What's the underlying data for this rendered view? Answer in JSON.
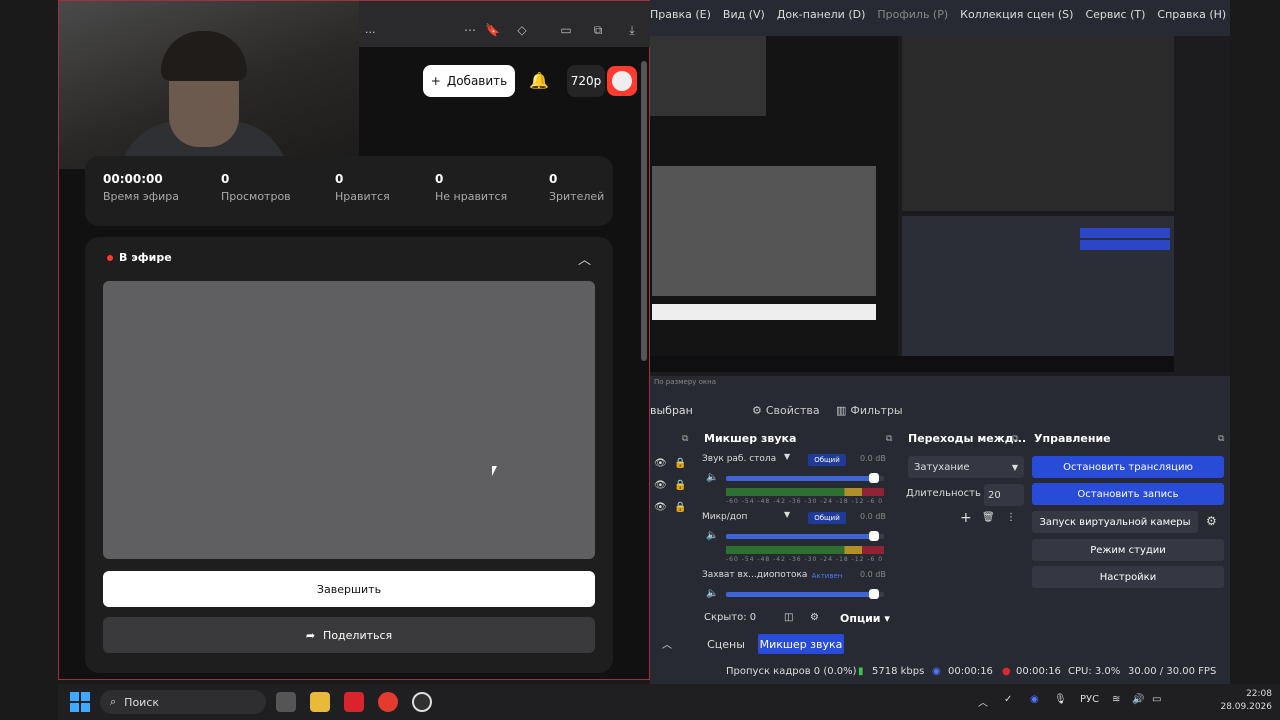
{
  "browser": {
    "add_label": "Добавить",
    "resolution": "720p",
    "addr": "...",
    "stats": [
      {
        "value": "00:00:00",
        "label": "Время эфира"
      },
      {
        "value": "0",
        "label": "Просмотров"
      },
      {
        "value": "0",
        "label": "Нравится"
      },
      {
        "value": "0",
        "label": "Не нравится"
      },
      {
        "value": "0",
        "label": "Зрителей"
      }
    ],
    "live_title": "В эфире",
    "end_label": "Завершить",
    "share_label": "Поделиться"
  },
  "obs": {
    "menu": [
      "Правка (E)",
      "Вид (V)",
      "Док-панели (D)",
      "Профиль (P)",
      "Коллекция сцен (S)",
      "Сервис (T)",
      "Справка (H)"
    ],
    "scale_label": "По размеру окна",
    "not_selected": "выбран",
    "props_tab": "Свойства",
    "filters_tab": "Фильтры",
    "mixer_title": "Микшер звука",
    "transitions_title": "Переходы межд...",
    "controls_title": "Управление",
    "mixer": [
      {
        "name": "Звук раб. стола",
        "badge": "Общий",
        "db": "0.0 dB",
        "level": 0.97
      },
      {
        "name": "Микр/доп",
        "badge": "Общий",
        "db": "0.0 dB",
        "level": 0.97
      },
      {
        "name": "Захват вх...диопотока",
        "badge": "Активен",
        "db": "0.0 dB",
        "level": 0.97
      }
    ],
    "meter_ticks": "-60 -54 -48 -42 -36 -30 -24 -18 -12 -6 0",
    "transition": "Затухание",
    "duration_label": "Длительность",
    "duration_value": "20",
    "controls": [
      {
        "label": "Остановить трансляцию",
        "style": "blue"
      },
      {
        "label": "Остановить запись",
        "style": "blue"
      },
      {
        "label": "Запуск виртуальной камеры",
        "style": "gray"
      },
      {
        "label": "Режим студии",
        "style": "gray"
      },
      {
        "label": "Настройки",
        "style": "gray"
      }
    ],
    "hidden_label": "Скрыто: 0",
    "options_label": "Опции",
    "tabs": [
      "Сцены",
      "Микшер звука"
    ],
    "status": {
      "dropped": "Пропуск кадров 0 (0.0%)",
      "bitrate": "5718 kbps",
      "stream_time": "00:00:16",
      "rec_time": "00:00:16",
      "cpu": "CPU: 3.0%",
      "fps": "30.00 / 30.00 FPS"
    }
  },
  "taskbar": {
    "search": "Поиск",
    "lang": "РУС",
    "time": "22:08",
    "date": "28.09.2026"
  },
  "colors": {
    "accent": "#284cd8",
    "live": "#ff3b30"
  }
}
